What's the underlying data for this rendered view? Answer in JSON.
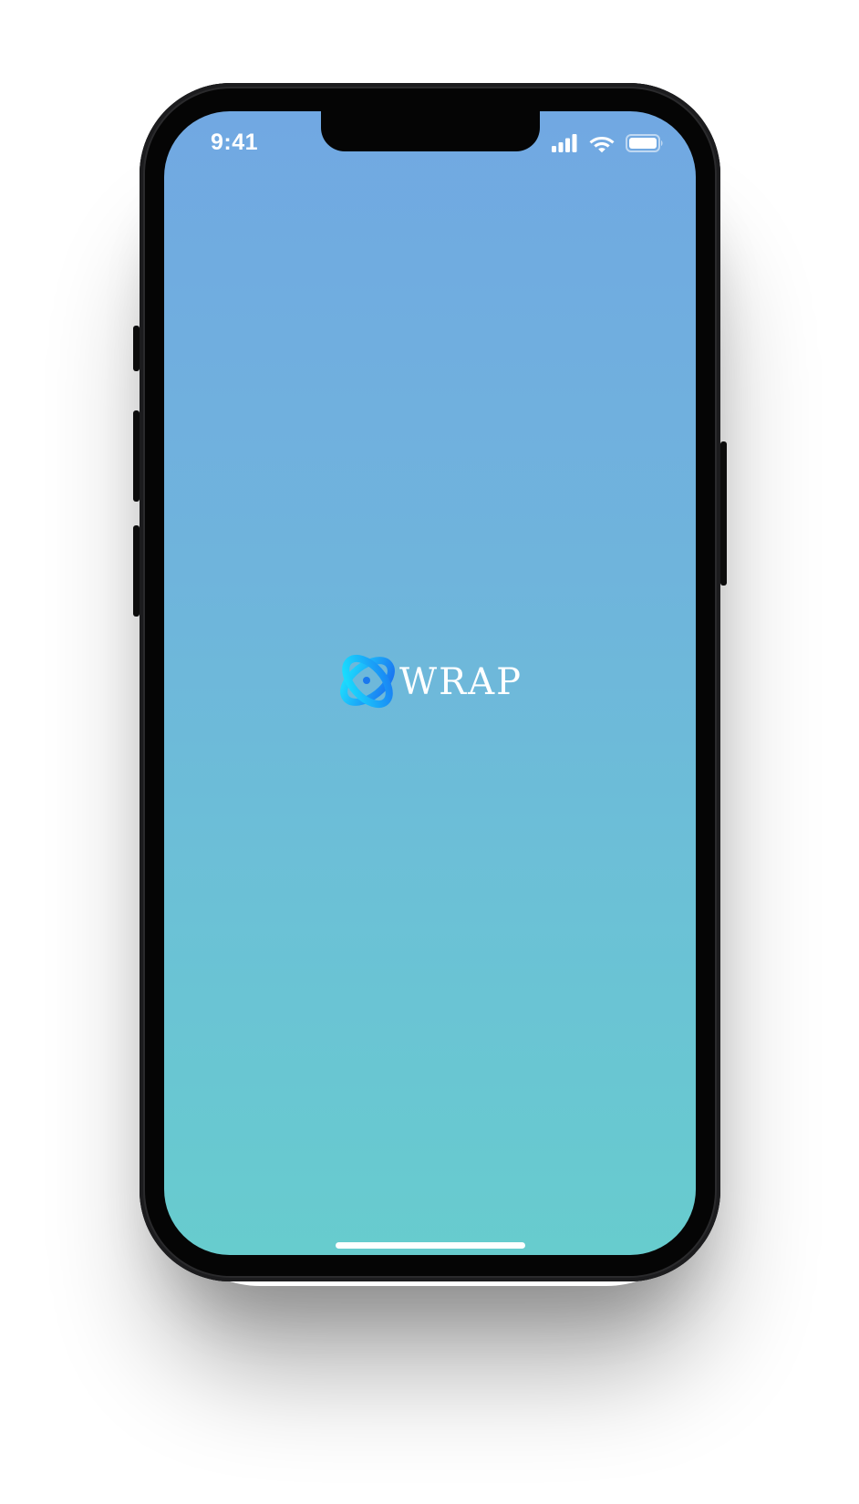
{
  "status_bar": {
    "time": "9:41",
    "icons": [
      "cellular-signal-icon",
      "wifi-icon",
      "battery-icon"
    ]
  },
  "splash": {
    "app_name": "WRAP",
    "logo_icon": "wrap-logo-icon"
  },
  "colors": {
    "gradient_top": "#71a8e2",
    "gradient_bottom": "#67ccce",
    "logo_cyan": "#1ee3ff",
    "logo_blue": "#1a6cf0",
    "text": "#ffffff"
  }
}
